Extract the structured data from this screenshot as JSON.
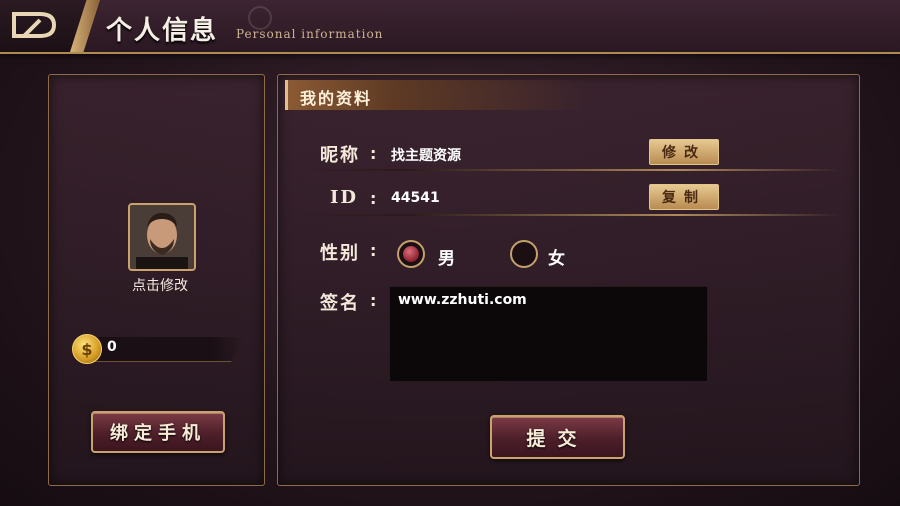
{
  "header": {
    "title": "个人信息",
    "subtitle": "Personal information"
  },
  "profile": {
    "avatar_caption": "点击修改",
    "coins": "0",
    "bind_phone_label": "绑定手机"
  },
  "section": {
    "title": "我的资料"
  },
  "form": {
    "nickname_label": "昵称",
    "nickname_value": "找主题资源",
    "edit_button": "修改",
    "id_label": "ID",
    "id_value": "44541",
    "copy_button": "复制",
    "gender_label": "性别",
    "gender_male": "男",
    "gender_female": "女",
    "gender_selected": "男",
    "signature_label": "签名",
    "signature_value": "www.zzhuti.com",
    "colon": ":",
    "submit_label": "提交"
  },
  "colors": {
    "accent_gold": "#c9a36b",
    "background": "#24151c",
    "button_maroon": "#4d1f29"
  },
  "icons": [
    "back-icon",
    "coin-icon",
    "avatar-photo"
  ]
}
